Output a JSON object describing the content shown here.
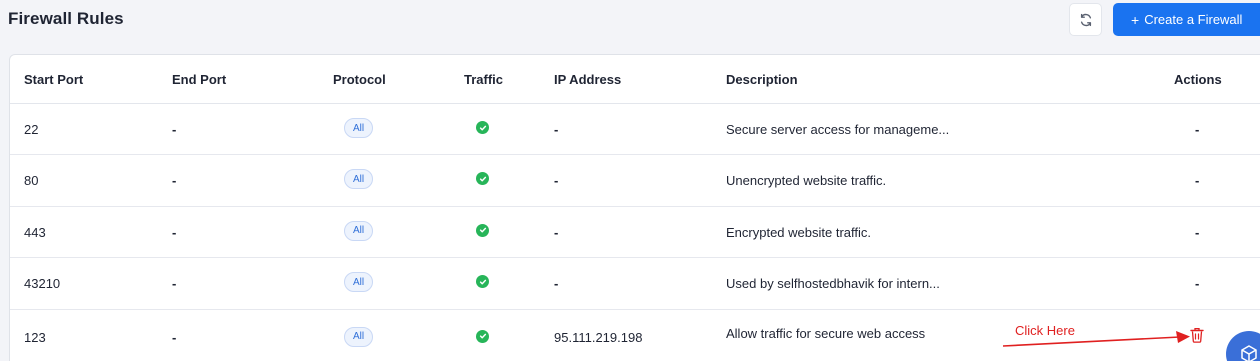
{
  "header": {
    "title": "Firewall Rules",
    "create_label": "Create a Firewall",
    "plus": "+",
    "refresh_icon": "refresh-icon"
  },
  "table": {
    "columns": [
      "Start Port",
      "End Port",
      "Protocol",
      "Traffic",
      "IP Address",
      "Description",
      "Actions"
    ],
    "rows": [
      {
        "start": "22",
        "end": "-",
        "protocol": "All",
        "ip": "-",
        "desc": "Secure server access for manageme...",
        "action": "-"
      },
      {
        "start": "80",
        "end": "-",
        "protocol": "All",
        "ip": "-",
        "desc": "Unencrypted website traffic.",
        "action": "-"
      },
      {
        "start": "443",
        "end": "-",
        "protocol": "All",
        "ip": "-",
        "desc": "Encrypted website traffic.",
        "action": "-"
      },
      {
        "start": "43210",
        "end": "-",
        "protocol": "All",
        "ip": "-",
        "desc": "Used by selfhostedbhavik for intern...",
        "action": "-"
      },
      {
        "start": "123",
        "end": "-",
        "protocol": "All",
        "ip": "95.111.219.198",
        "desc": "Allow traffic for secure web access",
        "action": "trash-icon"
      }
    ]
  },
  "annotation": {
    "text": "Click Here",
    "color": "#e02020"
  },
  "colors": {
    "accent": "#1a73f0",
    "success": "#27b559",
    "danger": "#e02020"
  }
}
